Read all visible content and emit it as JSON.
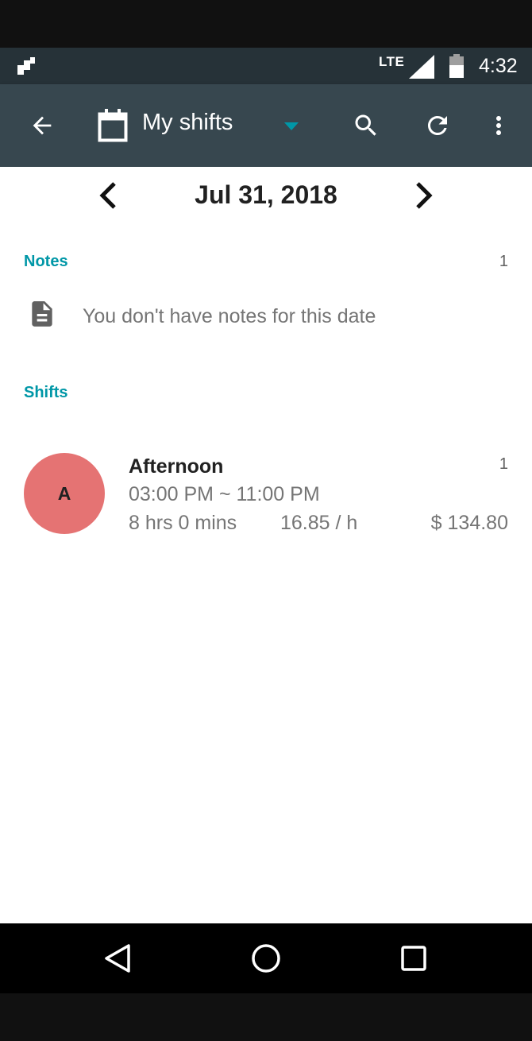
{
  "status_bar": {
    "network": "LTE",
    "time": "4:32",
    "icons": [
      "notification-icon",
      "signal-icon",
      "battery-icon"
    ]
  },
  "app_bar": {
    "title": "My shifts",
    "icons": [
      "back-arrow-icon",
      "calendar-icon",
      "dropdown-arrow-icon",
      "search-icon",
      "refresh-icon",
      "more-vert-icon"
    ],
    "accent_color": "#0097a7",
    "background_color": "#37474f"
  },
  "date_nav": {
    "date": "Jul 31, 2018",
    "icons": [
      "chevron-left-icon",
      "chevron-right-icon"
    ]
  },
  "notes": {
    "title": "Notes",
    "count": "1",
    "empty_text": "You don't have notes for this date",
    "icon": "note-icon"
  },
  "shifts": {
    "title": "Shifts",
    "items": [
      {
        "avatar_letter": "A",
        "avatar_color": "#e57373",
        "name": "Afternoon",
        "count": "1",
        "time_range": "03:00 PM ~ 11:00 PM",
        "duration": "8 hrs 0 mins",
        "rate": "16.85 / h",
        "pay": "$ 134.80"
      }
    ]
  },
  "nav_bar": {
    "icons": [
      "nav-back-icon",
      "nav-home-icon",
      "nav-recents-icon"
    ]
  }
}
